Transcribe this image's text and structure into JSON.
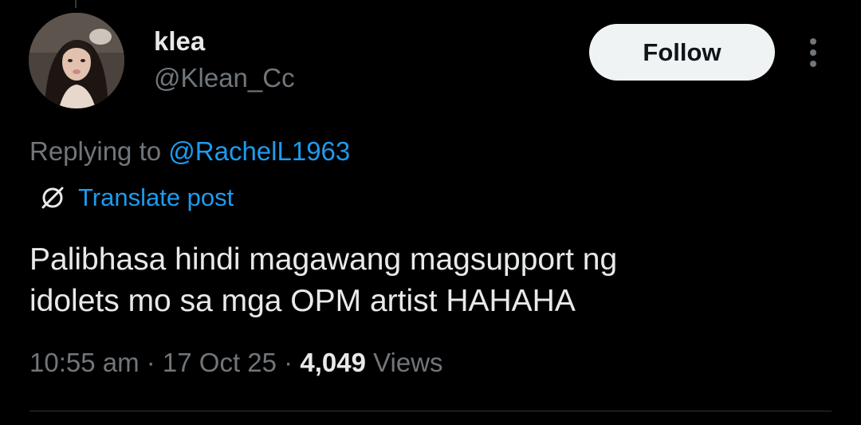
{
  "author": {
    "display_name": "klea",
    "handle": "@Klean_Cc",
    "avatar_icon": "profile-photo"
  },
  "actions": {
    "follow_label": "Follow",
    "more_icon": "more-vertical-icon"
  },
  "reply": {
    "prefix": "Replying to ",
    "mention": "@RachelL1963"
  },
  "translate": {
    "label": "Translate post",
    "icon": "globe-icon"
  },
  "post": {
    "lines": [
      "Palibhasa hindi magawang magsupport ng",
      "idolets mo sa mga OPM artist HAHAHA"
    ]
  },
  "meta": {
    "time": "10:55 am",
    "separator": " · ",
    "date": "17 Oct 25",
    "views_count": "4,049",
    "views_label": " Views"
  },
  "colors": {
    "background": "#000000",
    "primary_text": "#e7e9ea",
    "secondary_text": "#71767b",
    "accent": "#1d9bf0",
    "follow_bg": "#eff3f4",
    "divider": "#2f3336"
  }
}
